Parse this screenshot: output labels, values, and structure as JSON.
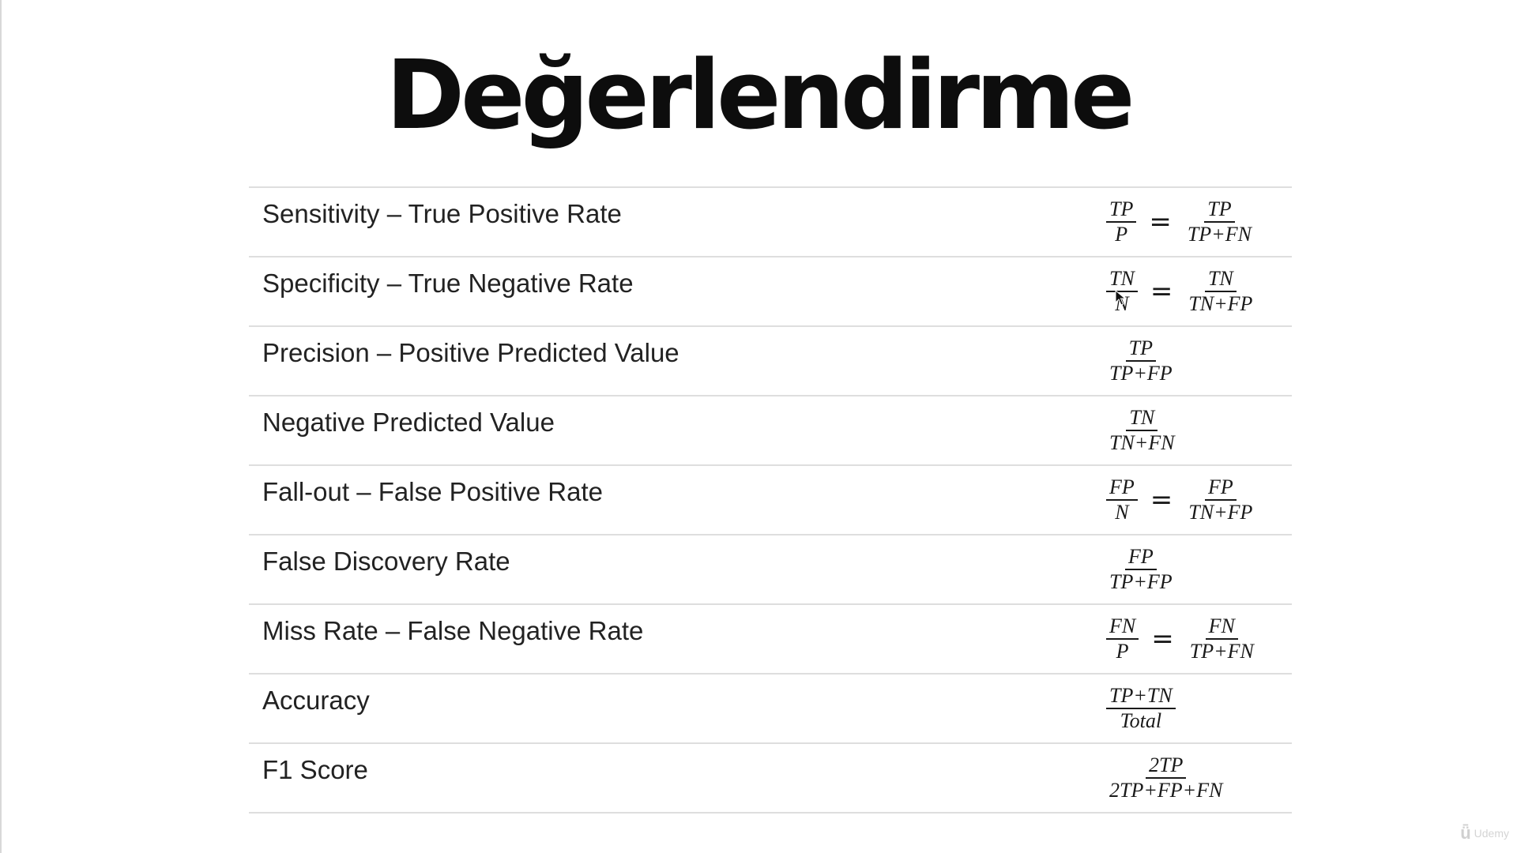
{
  "title": "Değerlendirme",
  "metrics": [
    {
      "name": "Sensitivity – True Positive Rate",
      "formula": {
        "left": {
          "num": "TP",
          "den": "P"
        },
        "right": {
          "num": "TP",
          "den": "TP+FN"
        }
      }
    },
    {
      "name": "Specificity – True Negative Rate",
      "formula": {
        "left": {
          "num": "TN",
          "den": "N"
        },
        "right": {
          "num": "TN",
          "den": "TN+FP"
        }
      }
    },
    {
      "name": "Precision – Positive Predicted Value",
      "formula": {
        "left": {
          "num": "TP",
          "den": "TP+FP"
        }
      }
    },
    {
      "name": "Negative Predicted Value",
      "formula": {
        "left": {
          "num": "TN",
          "den": "TN+FN"
        }
      }
    },
    {
      "name": "Fall-out – False Positive Rate",
      "formula": {
        "left": {
          "num": "FP",
          "den": "N"
        },
        "right": {
          "num": "FP",
          "den": "TN+FP"
        }
      }
    },
    {
      "name": "False Discovery Rate",
      "formula": {
        "left": {
          "num": "FP",
          "den": "TP+FP"
        }
      }
    },
    {
      "name": "Miss Rate – False Negative Rate",
      "formula": {
        "left": {
          "num": "FN",
          "den": "P"
        },
        "right": {
          "num": "FN",
          "den": "TP+FN"
        }
      }
    },
    {
      "name": "Accuracy",
      "formula": {
        "left": {
          "num": "TP+TN",
          "den": "Total"
        }
      }
    },
    {
      "name": "F1 Score",
      "formula": {
        "left": {
          "num": "2TP",
          "den": "2TP+FP+FN"
        }
      }
    }
  ],
  "equals_sign": "=",
  "watermark": {
    "mark": "ǖ",
    "text": "Udemy"
  },
  "colors": {
    "text": "#222222",
    "rule": "#dedede",
    "watermark": "#d4d4d4"
  }
}
